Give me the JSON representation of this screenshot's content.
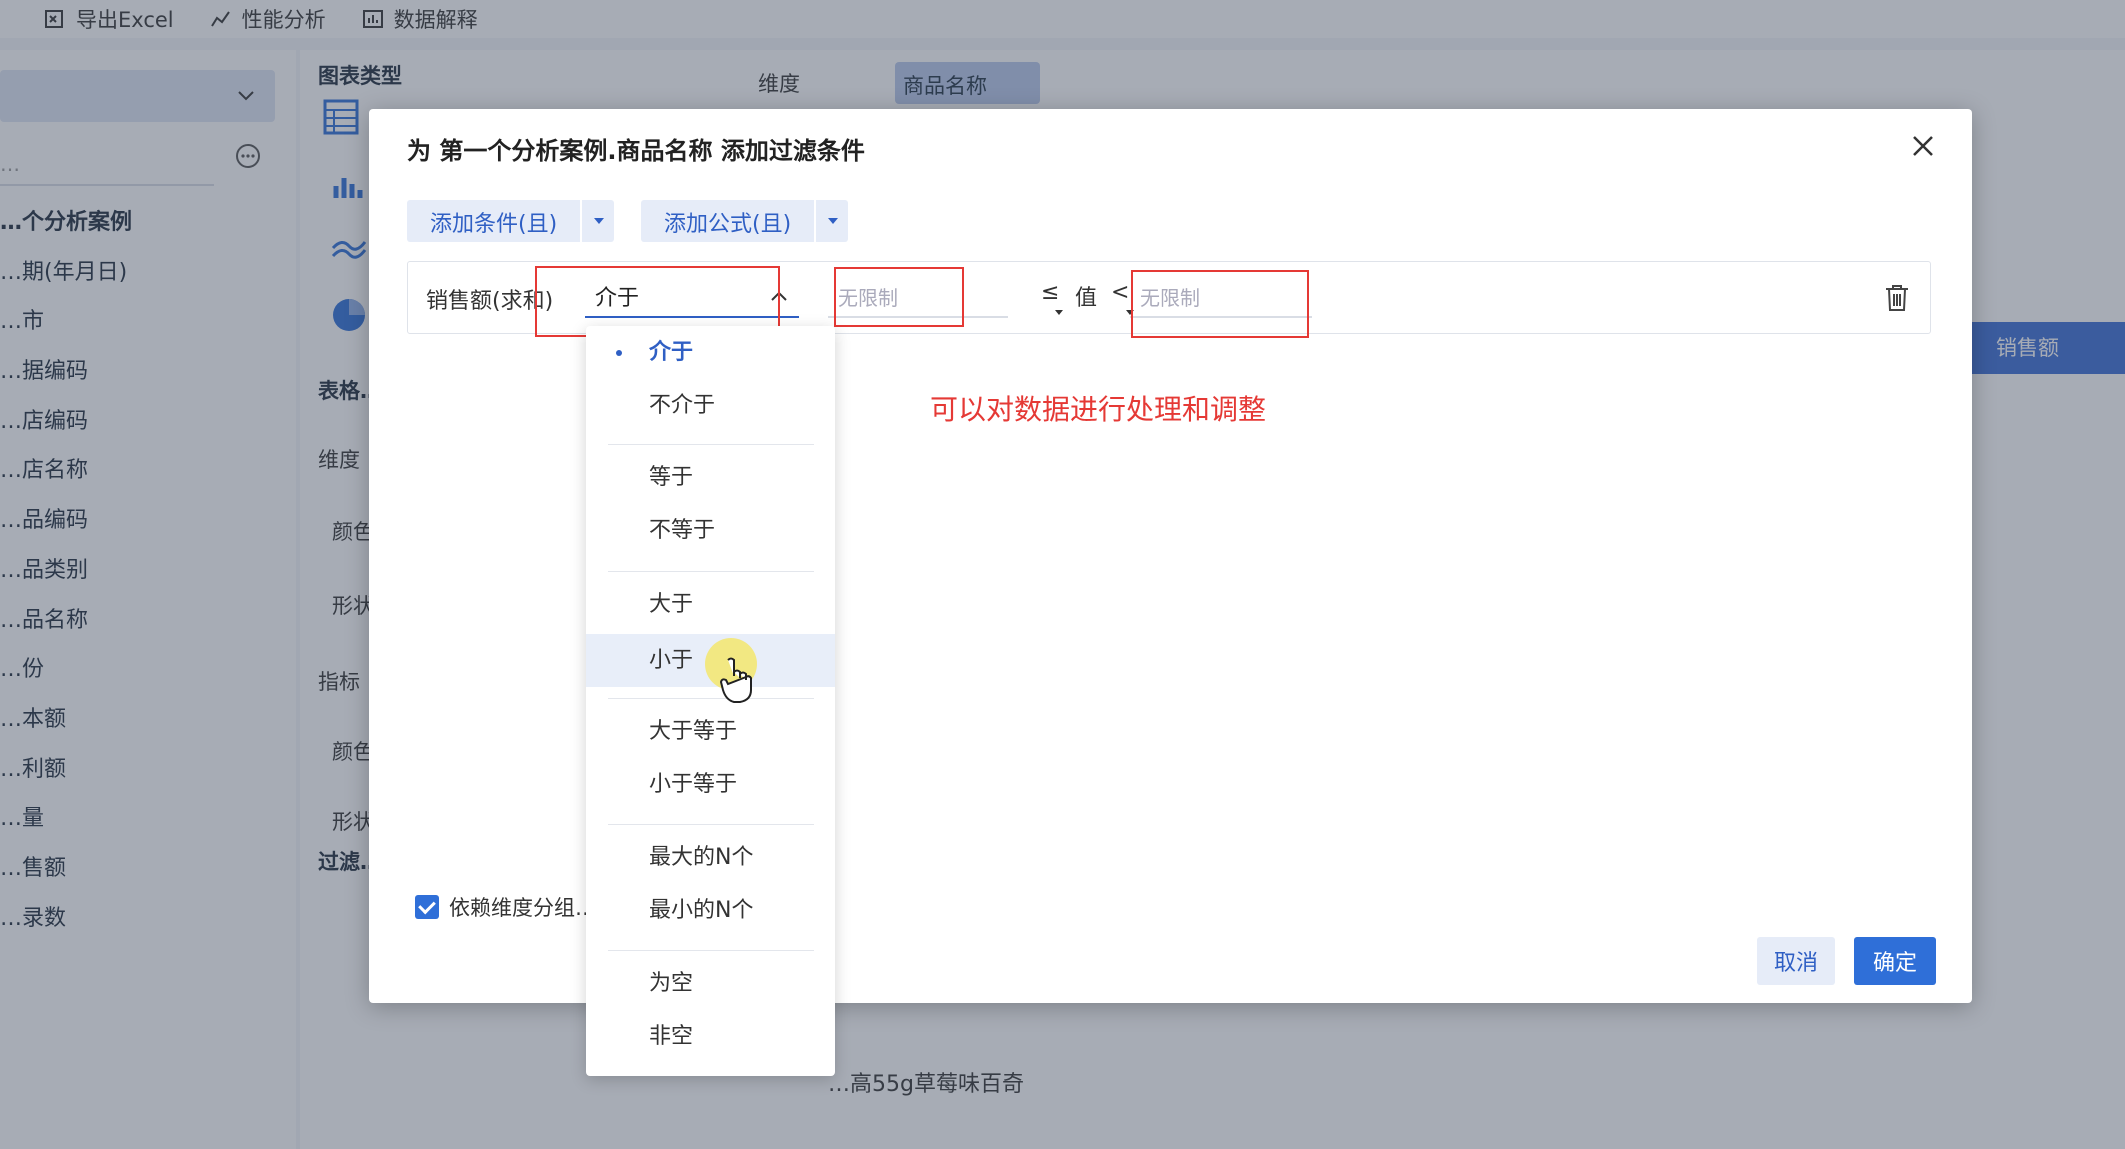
{
  "toolbar": {
    "export_excel": "导出Excel",
    "perf_analysis": "性能分析",
    "data_explain": "数据解释"
  },
  "left_panel": {
    "search_placeholder": "…",
    "fields": [
      {
        "label": "…个分析案例",
        "group": true
      },
      {
        "label": "…期(年月日)"
      },
      {
        "label": "…市"
      },
      {
        "label": "…据编码"
      },
      {
        "label": "…店编码"
      },
      {
        "label": "…店名称"
      },
      {
        "label": "…品编码"
      },
      {
        "label": "…品类别"
      },
      {
        "label": "…品名称"
      },
      {
        "label": "…份"
      },
      {
        "label": "…本额"
      },
      {
        "label": "…利额"
      },
      {
        "label": "…量"
      },
      {
        "label": "…售额"
      },
      {
        "label": "…录数"
      }
    ]
  },
  "mid_panel": {
    "chart_type": "图表类型",
    "table_attr": "表格…",
    "dimension": "维度",
    "color1": "颜色",
    "shape1": "形状",
    "metric": "指标",
    "color2": "颜色",
    "shape2": "形状",
    "filter": "过滤…"
  },
  "right_area": {
    "dimension_label": "维度",
    "dimension_chip": "商品名称",
    "column_header": "销售额",
    "cell_text": "…高55g草莓味百奇"
  },
  "dialog": {
    "title": "为 第一个分析案例.商品名称 添加过滤条件",
    "add_condition": "添加条件(且)",
    "add_formula": "添加公式(且)",
    "field_name": "销售额(求和)",
    "operator": "介于",
    "min_placeholder": "无限制",
    "max_placeholder": "无限制",
    "leq_symbol": "≤",
    "value_label": "值",
    "lt_symbol": "<",
    "annotation": "可以对数据进行处理和调整",
    "group_checkbox": "依赖维度分组…",
    "cancel": "取消",
    "confirm": "确定"
  },
  "dropdown": {
    "options": [
      "介于",
      "不介于",
      "等于",
      "不等于",
      "大于",
      "小于",
      "大于等于",
      "小于等于",
      "最大的N个",
      "最小的N个",
      "为空",
      "非空"
    ],
    "selected": "介于",
    "hovered": "小于"
  },
  "colors": {
    "accent": "#2f6fd8",
    "highlight": "#e53935"
  }
}
